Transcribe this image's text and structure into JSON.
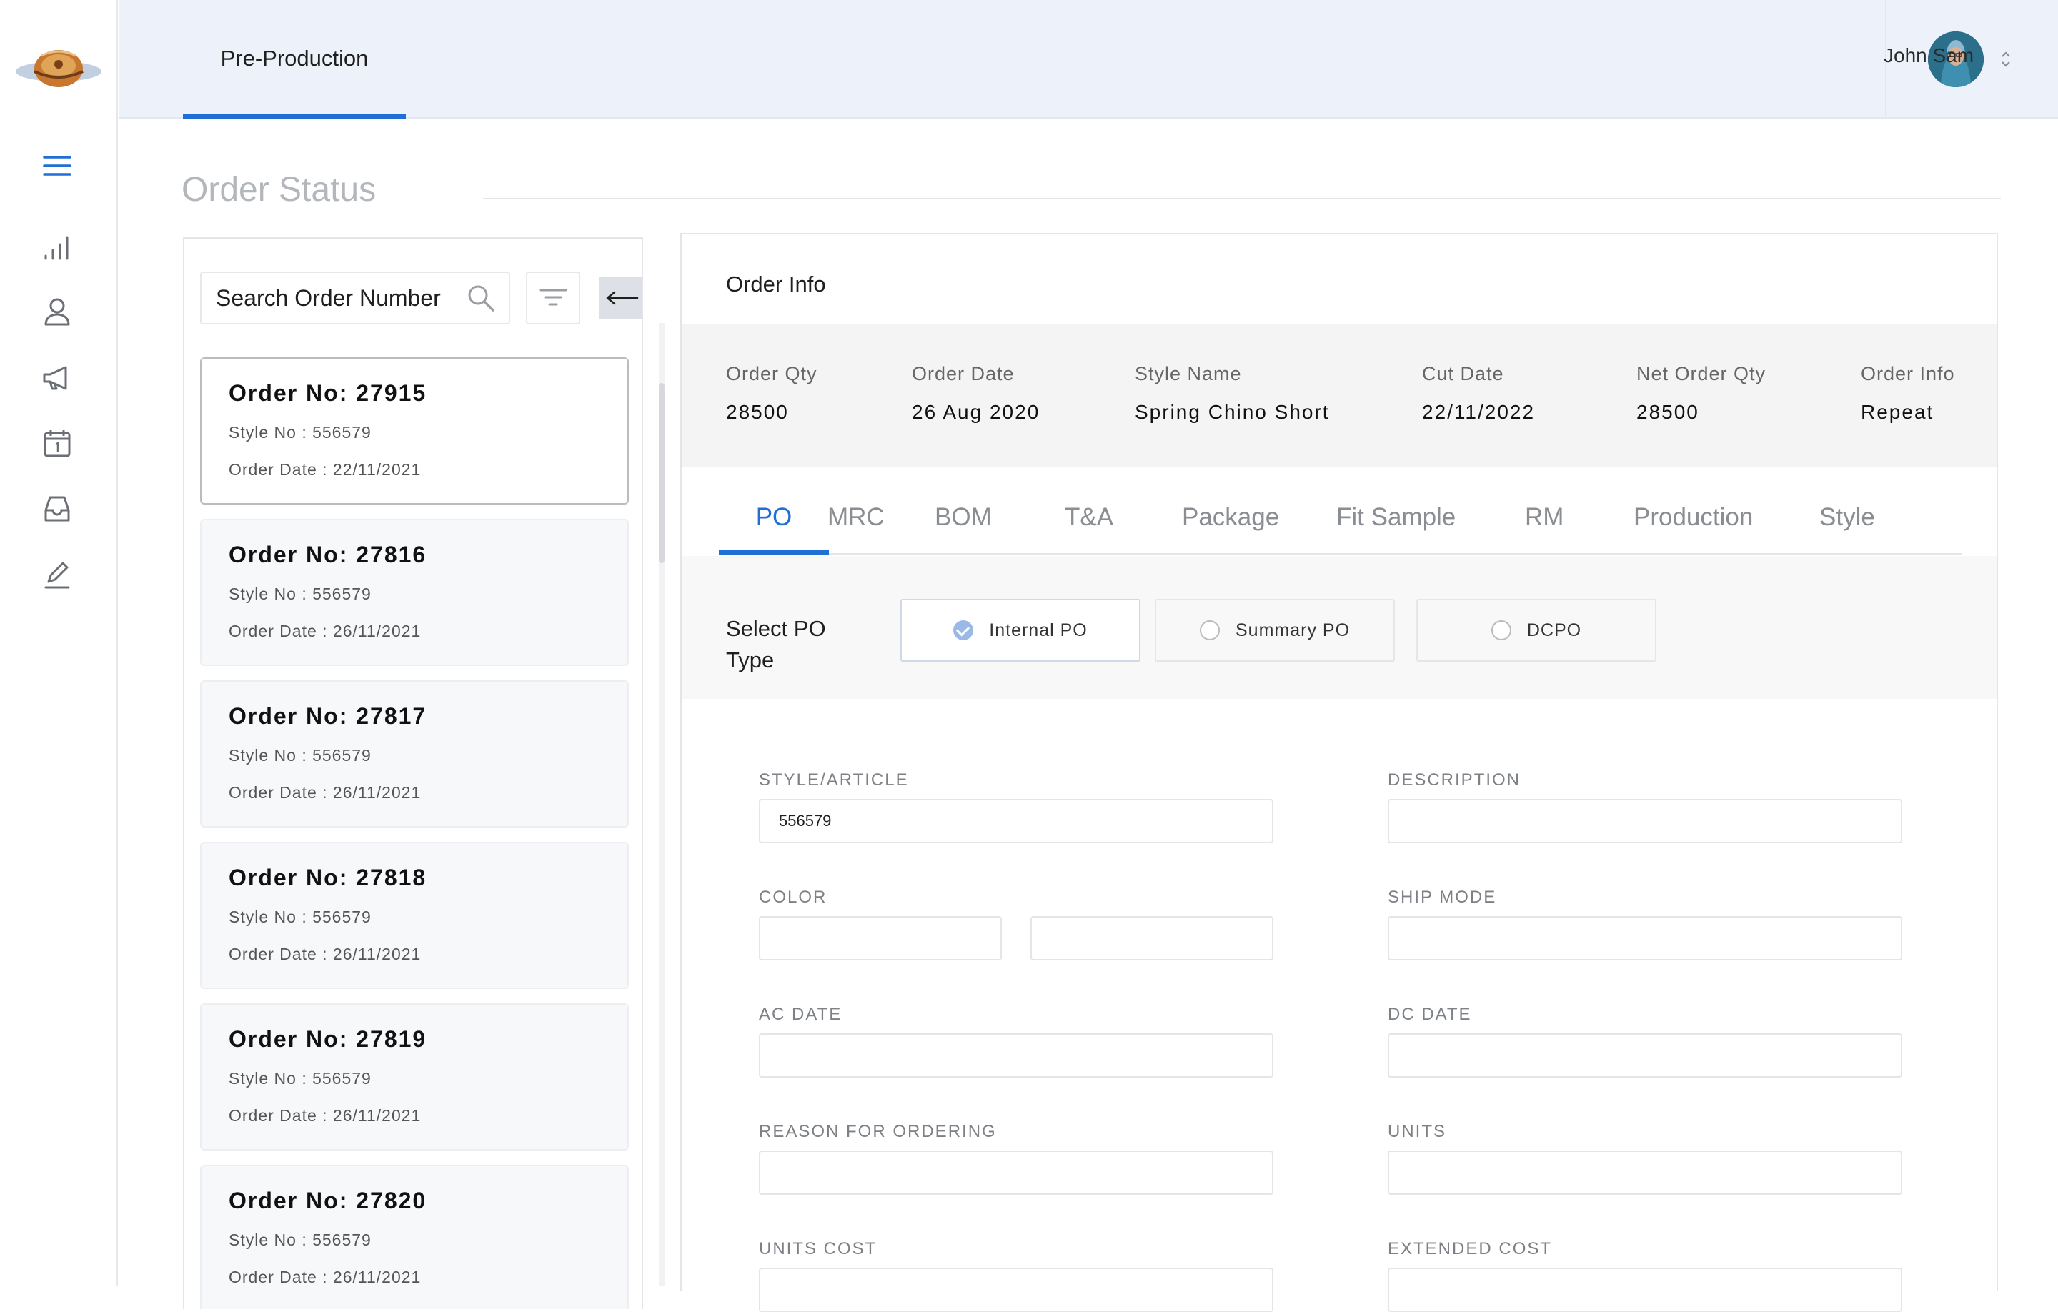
{
  "header": {
    "tab": "Pre-Production",
    "user_name": "John Sam"
  },
  "sidebar": {
    "icons": [
      "menu-icon",
      "chart-icon",
      "user-icon",
      "megaphone-icon",
      "calendar-icon",
      "inbox-icon",
      "edit-icon"
    ]
  },
  "page": {
    "title": "Order Status"
  },
  "search": {
    "placeholder": "Search Order Number"
  },
  "orders": [
    {
      "order_no": "Order No: 27915",
      "style_no": "Style No : 556579",
      "order_date": "Order Date : 22/11/2021"
    },
    {
      "order_no": "Order No: 27816",
      "style_no": "Style No : 556579",
      "order_date": "Order Date : 26/11/2021"
    },
    {
      "order_no": "Order No: 27817",
      "style_no": "Style No : 556579",
      "order_date": "Order Date : 26/11/2021"
    },
    {
      "order_no": "Order No: 27818",
      "style_no": "Style No : 556579",
      "order_date": "Order Date : 26/11/2021"
    },
    {
      "order_no": "Order No: 27819",
      "style_no": "Style No : 556579",
      "order_date": "Order Date : 26/11/2021"
    },
    {
      "order_no": "Order No: 27820",
      "style_no": "Style No : 556579",
      "order_date": "Order Date : 26/11/2021"
    }
  ],
  "order_info": {
    "title": "Order Info",
    "summary": [
      {
        "label": "Order Qty",
        "value": "28500"
      },
      {
        "label": "Order Date",
        "value": "26 Aug 2020"
      },
      {
        "label": "Style Name",
        "value": "Spring Chino Short"
      },
      {
        "label": "Cut Date",
        "value": "22/11/2022"
      },
      {
        "label": "Net Order Qty",
        "value": "28500"
      },
      {
        "label": "Order Info",
        "value": "Repeat"
      }
    ],
    "tabs": [
      "PO",
      "MRC",
      "BOM",
      "T&A",
      "Package",
      "Fit Sample",
      "RM",
      "Production",
      "Style"
    ],
    "active_tab": "PO",
    "po_type": {
      "label": "Select PO Type",
      "options": [
        "Internal PO",
        "Summary PO",
        "DCPO"
      ],
      "selected": "Internal PO"
    },
    "fields": {
      "style_article": {
        "label": "STYLE/ARTICLE",
        "value": "556579"
      },
      "description": {
        "label": "DESCRIPTION",
        "value": ""
      },
      "color": {
        "label": "COLOR",
        "value_1": "",
        "value_2": ""
      },
      "ship_mode": {
        "label": "SHIP MODE",
        "value": ""
      },
      "ac_date": {
        "label": "AC DATE",
        "value": ""
      },
      "dc_date": {
        "label": "DC DATE",
        "value": ""
      },
      "reason": {
        "label": "REASON FOR ORDERING",
        "value": ""
      },
      "units": {
        "label": "UNITS",
        "value": ""
      },
      "units_cost": {
        "label": "UNITS COST",
        "value": ""
      },
      "extended_cost": {
        "label": "EXTENDED COST",
        "value": ""
      }
    }
  },
  "colors": {
    "accent": "#1f6fd6",
    "topbar_bg": "#edf2fa"
  }
}
